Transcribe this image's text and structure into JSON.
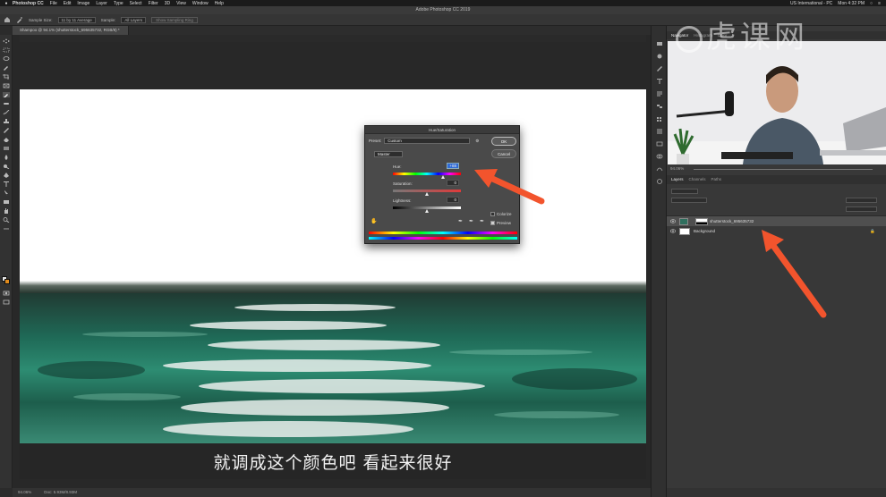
{
  "menubar": {
    "app_name": "Photoshop CC",
    "items": [
      "File",
      "Edit",
      "Image",
      "Layer",
      "Type",
      "Select",
      "Filter",
      "3D",
      "View",
      "Window",
      "Help"
    ],
    "input_source": "US International - PC",
    "clock": "Mon 4:32 PM"
  },
  "window": {
    "title": "Adobe Photoshop CC 2019"
  },
  "options_bar": {
    "sample_size_label": "Sample Size:",
    "sample_size_value": "11 by 11 Average",
    "sample_label": "Sample:",
    "sample_value": "All Layers",
    "sampling_ring_label": "Show Sampling Ring"
  },
  "document": {
    "tab_label": "Shampoo @ 94.1% (shutterstock_695635732, RGB/8) *",
    "status_zoom": "94.06%",
    "status_doc": "Doc: 5.93M/8.93M"
  },
  "subtitle": "就调成这个颜色吧 看起来很好",
  "dialog": {
    "title": "Hue/Saturation",
    "preset_label": "Preset:",
    "preset_value": "Custom",
    "ok_label": "OK",
    "cancel_label": "Cancel",
    "channel_value": "Master",
    "hue_label": "Hue:",
    "hue_value": "+88",
    "hue_fraction": 0.744,
    "saturation_label": "Saturation:",
    "saturation_value": "0",
    "saturation_fraction": 0.5,
    "lightness_label": "Lightness:",
    "lightness_value": "0",
    "lightness_fraction": 0.5,
    "colorize_label": "Colorize",
    "colorize_checked": false,
    "preview_label": "Preview",
    "preview_checked": true
  },
  "navigator": {
    "tabs": [
      "Navigator",
      "Histogram",
      "Color"
    ],
    "zoom_value": "94.06%"
  },
  "layers_panel": {
    "tabs": [
      "Layers",
      "Channels",
      "Paths"
    ],
    "layers": [
      {
        "name": "shutterstock_695635732",
        "selected": true
      },
      {
        "name": "Background",
        "selected": false
      }
    ]
  },
  "watermark": "虎课网",
  "colors": {
    "accent_arrow": "#f2542d",
    "highlight_value": "#2f6bd8",
    "foreground_swatch": "#e6e6e6",
    "background_swatch": "#e08a1c"
  }
}
